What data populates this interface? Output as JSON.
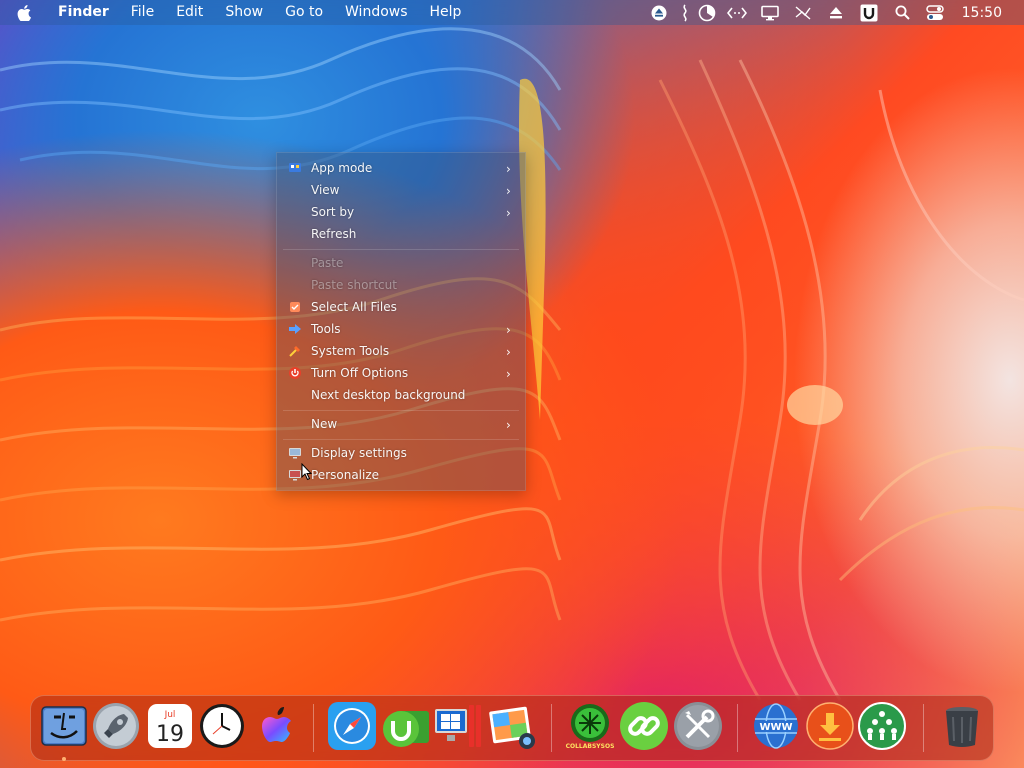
{
  "menubar": {
    "app_name": "Finder",
    "menus": [
      "File",
      "Edit",
      "Show",
      "Go to",
      "Windows",
      "Help"
    ],
    "clock": "15:50",
    "status_icons": [
      "eject-icon",
      "cable-icon",
      "pie-chart-icon",
      "code-brackets-icon",
      "monitor-icon",
      "muted-icon",
      "eject-alt-icon",
      "u-app-icon",
      "search-icon",
      "control-center-icon"
    ]
  },
  "context_menu": {
    "items": [
      {
        "label": "App mode",
        "icon": "app-mode-icon",
        "submenu": true,
        "enabled": true
      },
      {
        "label": "View",
        "submenu": true,
        "enabled": true
      },
      {
        "label": "Sort by",
        "submenu": true,
        "enabled": true
      },
      {
        "label": "Refresh",
        "submenu": false,
        "enabled": true
      },
      {
        "label": "Paste",
        "submenu": false,
        "enabled": false
      },
      {
        "label": "Paste shortcut",
        "submenu": false,
        "enabled": false
      },
      {
        "label": "Select All Files",
        "icon": "select-all-icon",
        "submenu": false,
        "enabled": true
      },
      {
        "label": "Tools",
        "icon": "tools-arrow-icon",
        "submenu": true,
        "enabled": true
      },
      {
        "label": "System Tools",
        "icon": "system-tools-icon",
        "submenu": true,
        "enabled": true
      },
      {
        "label": "Turn Off Options",
        "icon": "power-icon",
        "submenu": true,
        "enabled": true
      },
      {
        "label": "Next desktop background",
        "submenu": false,
        "enabled": true
      },
      {
        "label": "New",
        "submenu": true,
        "enabled": true
      },
      {
        "label": "Display settings",
        "icon": "display-settings-icon",
        "submenu": false,
        "enabled": true
      },
      {
        "label": "Personalize",
        "icon": "personalize-icon",
        "submenu": false,
        "enabled": true
      }
    ],
    "arrow_glyph": "›"
  },
  "dock": {
    "calendar": {
      "month": "Jul",
      "day": "19"
    },
    "collab_label": "COLLABSYSOS",
    "apps": [
      "Finder",
      "Launchpad",
      "Calendar",
      "Clock",
      "Siri",
      "Safari",
      "uTorrent",
      "Parallels Desktop",
      "Photos",
      "CollabSysOS",
      "Link",
      "System Utilities",
      "Web Browser",
      "Downloads",
      "Network",
      "Trash"
    ]
  },
  "colors": {
    "accent": "#ff5a16",
    "menubar_bg": "#285a96",
    "dock_bg": "#aa2814"
  }
}
